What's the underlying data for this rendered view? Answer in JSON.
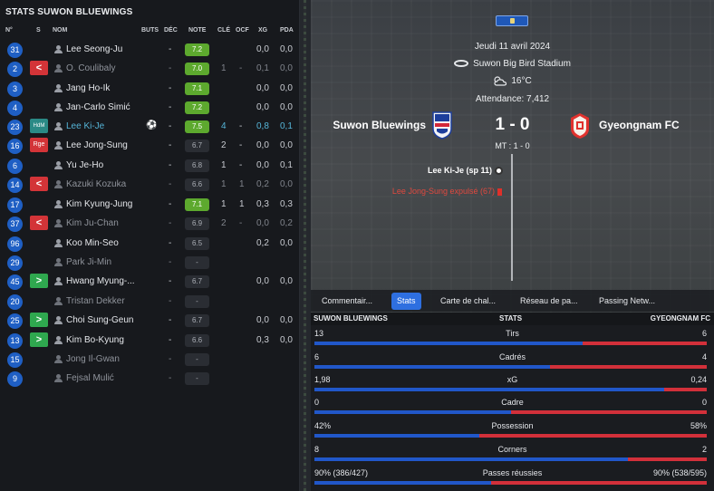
{
  "left_panel": {
    "title": "STATS SUWON BLUEWINGS",
    "columns": [
      "N°",
      "S",
      "NOM",
      "BUTS",
      "DÉC",
      "NOTE",
      "CLÉ",
      "OCF",
      "XG",
      "PDA"
    ],
    "players": [
      {
        "num": "31",
        "status": "",
        "name": "Lee Seong-Ju",
        "goals": "",
        "dec": "-",
        "note": "7.2",
        "note_level": "good",
        "cle": "",
        "ocf": "",
        "xg": "0,0",
        "pda": "0,0",
        "style": ""
      },
      {
        "num": "2",
        "status": "<",
        "status_type": "out",
        "name": "O. Coulibaly",
        "goals": "",
        "dec": "-",
        "note": "7.0",
        "note_level": "good",
        "cle": "1",
        "ocf": "-",
        "xg": "0,1",
        "pda": "0,0",
        "style": "dim"
      },
      {
        "num": "3",
        "status": "",
        "name": "Jang Ho-Ik",
        "goals": "",
        "dec": "-",
        "note": "7.1",
        "note_level": "good",
        "cle": "",
        "ocf": "",
        "xg": "0,0",
        "pda": "0,0",
        "style": ""
      },
      {
        "num": "4",
        "status": "",
        "name": "Jan-Carlo Simić",
        "goals": "",
        "dec": "-",
        "note": "7.2",
        "note_level": "good",
        "cle": "",
        "ocf": "",
        "xg": "0,0",
        "pda": "0,0",
        "style": ""
      },
      {
        "num": "23",
        "status": "HdM",
        "status_type": "hdm",
        "name": "Lee Ki-Je",
        "goals": "⚽",
        "dec": "-",
        "note": "7.5",
        "note_level": "good",
        "cle": "4",
        "ocf": "-",
        "xg": "0,8",
        "pda": "0,1",
        "style": "hl"
      },
      {
        "num": "16",
        "status": "Rge",
        "status_type": "rge",
        "name": "Lee Jong-Sung",
        "goals": "",
        "dec": "-",
        "note": "6.7",
        "note_level": "avg",
        "cle": "2",
        "ocf": "-",
        "xg": "0,0",
        "pda": "0,0",
        "style": ""
      },
      {
        "num": "6",
        "status": "",
        "name": "Yu Je-Ho",
        "goals": "",
        "dec": "-",
        "note": "6.8",
        "note_level": "avg",
        "cle": "1",
        "ocf": "-",
        "xg": "0,0",
        "pda": "0,1",
        "style": ""
      },
      {
        "num": "14",
        "status": "<",
        "status_type": "out",
        "name": "Kazuki Kozuka",
        "goals": "",
        "dec": "-",
        "note": "6.6",
        "note_level": "avg",
        "cle": "1",
        "ocf": "1",
        "xg": "0,2",
        "pda": "0,0",
        "style": "dim"
      },
      {
        "num": "17",
        "status": "",
        "name": "Kim Kyung-Jung",
        "goals": "",
        "dec": "-",
        "note": "7.1",
        "note_level": "good",
        "cle": "1",
        "ocf": "1",
        "xg": "0,3",
        "pda": "0,3",
        "style": ""
      },
      {
        "num": "37",
        "status": "<",
        "status_type": "out",
        "name": "Kim Ju-Chan",
        "goals": "",
        "dec": "-",
        "note": "6.9",
        "note_level": "avg",
        "cle": "2",
        "ocf": "-",
        "xg": "0,0",
        "pda": "0,2",
        "style": "dim"
      },
      {
        "num": "96",
        "status": "",
        "name": "Koo Min-Seo",
        "goals": "",
        "dec": "-",
        "note": "6.5",
        "note_level": "avg",
        "cle": "",
        "ocf": "",
        "xg": "0,2",
        "pda": "0,0",
        "style": ""
      },
      {
        "num": "29",
        "status": "",
        "name": "Park Ji-Min",
        "goals": "",
        "dec": "-",
        "note": "-",
        "note_level": "none",
        "cle": "",
        "ocf": "",
        "xg": "",
        "pda": "",
        "style": "dim"
      },
      {
        "num": "45",
        "status": ">",
        "status_type": "in",
        "name": "Hwang Myung-...",
        "goals": "",
        "dec": "-",
        "note": "6.7",
        "note_level": "avg",
        "cle": "",
        "ocf": "",
        "xg": "0,0",
        "pda": "0,0",
        "style": ""
      },
      {
        "num": "20",
        "status": "",
        "name": "Tristan Dekker",
        "goals": "",
        "dec": "-",
        "note": "-",
        "note_level": "none",
        "cle": "",
        "ocf": "",
        "xg": "",
        "pda": "",
        "style": "dim"
      },
      {
        "num": "25",
        "status": ">",
        "status_type": "in",
        "name": "Choi Sung-Geun",
        "goals": "",
        "dec": "-",
        "note": "6.7",
        "note_level": "avg",
        "cle": "",
        "ocf": "",
        "xg": "0,0",
        "pda": "0,0",
        "style": ""
      },
      {
        "num": "13",
        "status": ">",
        "status_type": "in",
        "name": "Kim Bo-Kyung",
        "goals": "",
        "dec": "-",
        "note": "6.6",
        "note_level": "avg",
        "cle": "",
        "ocf": "",
        "xg": "0,3",
        "pda": "0,0",
        "style": ""
      },
      {
        "num": "15",
        "status": "",
        "name": "Jong Il-Gwan",
        "goals": "",
        "dec": "-",
        "note": "-",
        "note_level": "none",
        "cle": "",
        "ocf": "",
        "xg": "",
        "pda": "",
        "style": "dim"
      },
      {
        "num": "9",
        "status": "",
        "name": "Fejsal Mulić",
        "goals": "",
        "dec": "-",
        "note": "-",
        "note_level": "none",
        "cle": "",
        "ocf": "",
        "xg": "",
        "pda": "",
        "style": "dim"
      }
    ]
  },
  "match": {
    "date": "Jeudi 11 avril 2024",
    "stadium": "Suwon Big Bird Stadium",
    "temperature": "16°C",
    "attendance": "Attendance: 7,412",
    "home_team": "Suwon Bluewings",
    "away_team": "Gyeongnam FC",
    "score": "1 - 0",
    "halftime": "MT : 1 - 0",
    "events": {
      "goal": "Lee Ki-Je (sp 11)",
      "red_card": "Lee Jong-Sung expulsé (67)"
    }
  },
  "tabs": [
    {
      "label": "Commentair...",
      "active": false
    },
    {
      "label": "Stats",
      "active": true
    },
    {
      "label": "Carte de chal...",
      "active": false
    },
    {
      "label": "Réseau de pa...",
      "active": false
    },
    {
      "label": "Passing Netw...",
      "active": false
    }
  ],
  "stats_header": {
    "home": "SUWON BLUEWINGS",
    "center": "STATS",
    "away": "GYEONGNAM FC"
  },
  "stats": [
    {
      "label": "Tirs",
      "home": "13",
      "away": "6",
      "home_share": 0.684
    },
    {
      "label": "Cadrés",
      "home": "6",
      "away": "4",
      "home_share": 0.6
    },
    {
      "label": "xG",
      "home": "1,98",
      "away": "0,24",
      "home_share": 0.892
    },
    {
      "label": "Cadre",
      "home": "0",
      "away": "0",
      "home_share": 0.5
    },
    {
      "label": "Possession",
      "home": "42%",
      "away": "58%",
      "home_share": 0.42
    },
    {
      "label": "Corners",
      "home": "8",
      "away": "2",
      "home_share": 0.8
    },
    {
      "label": "Passes réussies",
      "home": "90% (386/427)",
      "away": "90% (538/595)",
      "home_share": 0.45
    }
  ],
  "colors": {
    "home_blue": "#2157c9",
    "away_red": "#d2303a",
    "rating_green": "#5da92e",
    "active_tab": "#2e6fe0"
  }
}
